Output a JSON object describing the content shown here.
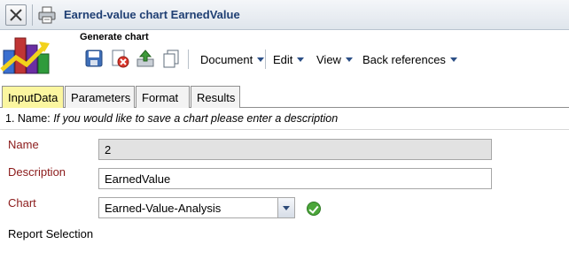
{
  "window": {
    "title": "Earned-value chart EarnedValue",
    "close_icon": "close-icon",
    "print_icon": "printer-icon"
  },
  "header": {
    "logo_icon": "chart-logo-icon",
    "section_label": "Generate chart"
  },
  "toolbar": {
    "icons": [
      "save-icon",
      "delete-icon",
      "upload-icon",
      "copy-icon"
    ],
    "menus": [
      {
        "label": "Document"
      },
      {
        "label": "Edit"
      },
      {
        "label": "View"
      },
      {
        "label": "Back references"
      }
    ]
  },
  "tabs": [
    {
      "label": "InputData",
      "active": true
    },
    {
      "label": "Parameters",
      "active": false
    },
    {
      "label": "Format",
      "active": false
    },
    {
      "label": "Results",
      "active": false
    }
  ],
  "form": {
    "step_prefix": "1. Name: ",
    "step_hint": "If you would like to save a chart please enter a description",
    "name_label": "Name",
    "name_value": "2",
    "description_label": "Description",
    "description_value": "EarnedValue",
    "chart_label": "Chart",
    "chart_value": "Earned-Value-Analysis",
    "chart_status_icon": "check-ok-icon",
    "report_selection_label": "Report Selection"
  },
  "colors": {
    "title_text": "#1f3f73",
    "active_tab": "#fbf6a0",
    "field_label": "#8b1a1a",
    "ok_green": "#4ba63a"
  }
}
